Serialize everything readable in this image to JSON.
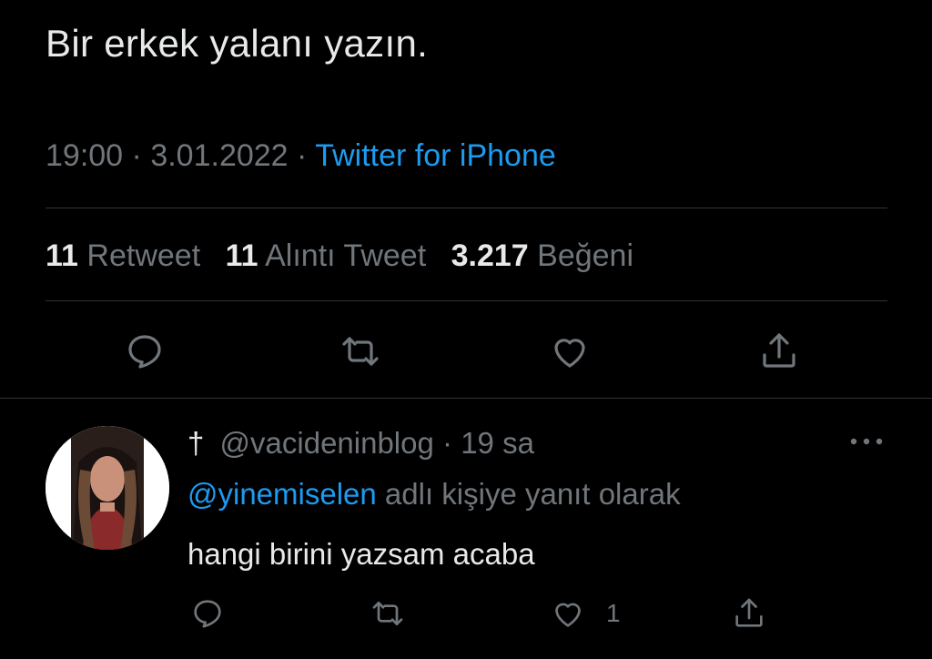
{
  "tweet": {
    "text": "Bir erkek yalanı yazın.",
    "time": "19:00",
    "separator": "·",
    "date": "3.01.2022",
    "source": "Twitter for iPhone"
  },
  "stats": {
    "retweets_count": "11",
    "retweets_label": "Retweet",
    "quotes_count": "11",
    "quotes_label": "Alıntı Tweet",
    "likes_count": "3.217",
    "likes_label": "Beğeni"
  },
  "icons": {
    "reply": "reply-icon",
    "retweet": "retweet-icon",
    "like": "heart-icon",
    "share": "share-icon",
    "more": "more-icon"
  },
  "reply": {
    "prefix": "†",
    "handle": "@vacideninblog",
    "separator": "·",
    "time": "19 sa",
    "mention": "@yinemiselen",
    "reply_to_suffix": "adlı kişiye yanıt olarak",
    "text": "hangi birini yazsam acaba",
    "like_count": "1"
  },
  "colors": {
    "background": "#000000",
    "text": "#e7e9ea",
    "muted": "#71767b",
    "accent": "#1d9bf0",
    "divider": "#2f3336"
  }
}
